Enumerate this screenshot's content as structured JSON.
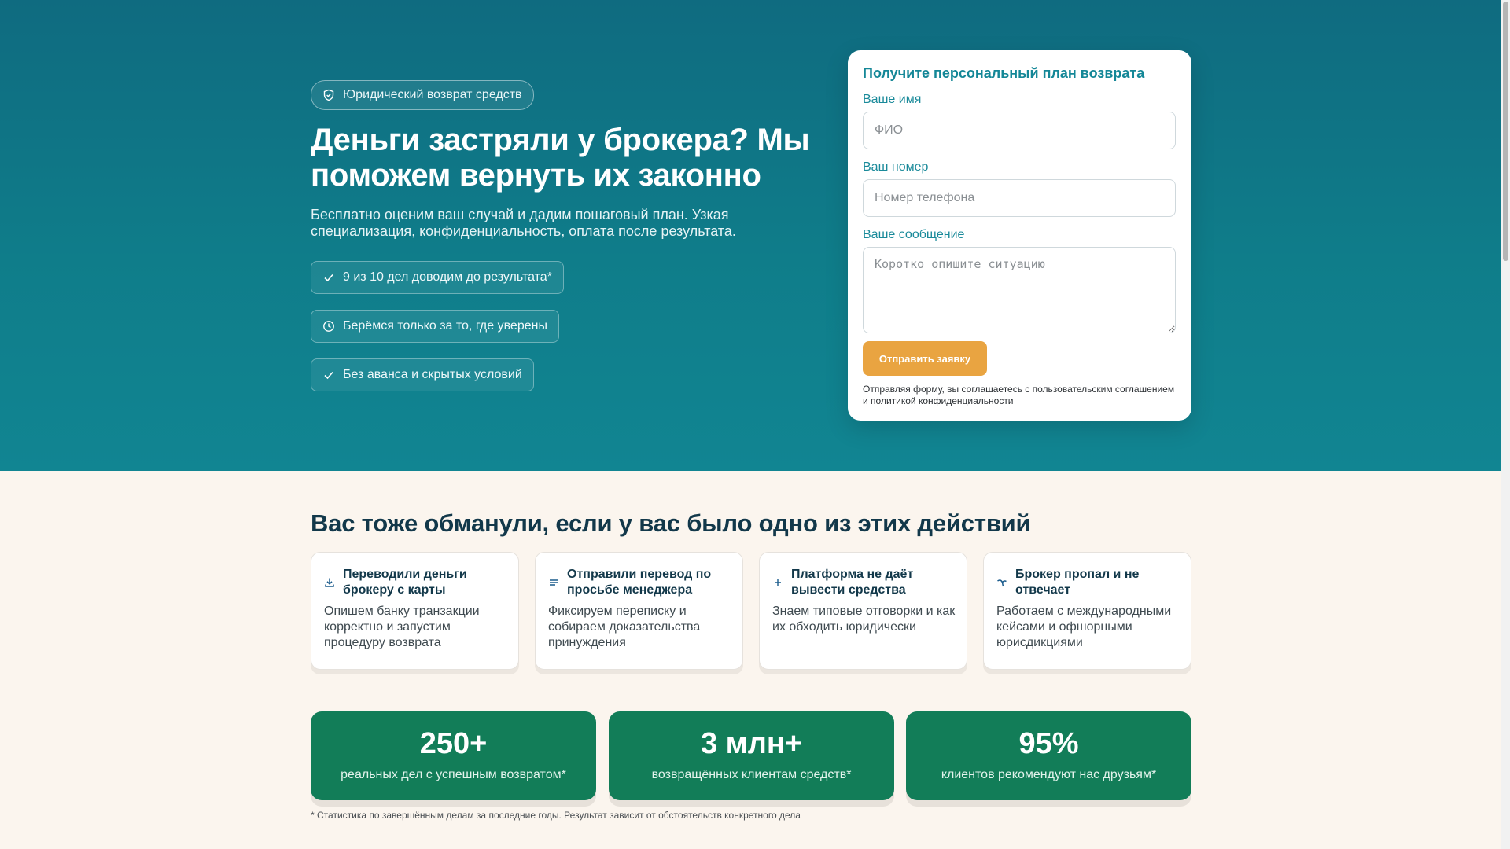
{
  "hero": {
    "badge": {
      "icon": "shield-icon",
      "label": "Юридический возврат средств"
    },
    "title": "Деньги застряли у брокера? Мы поможем вернуть их законно",
    "subtitle": "Бесплатно оценим ваш случай и дадим пошаговый план. Узкая специализация, конфиденциальность, оплата после результата.",
    "benefits": [
      {
        "icon": "check-icon",
        "label": "9 из 10 дел доводим до результата*"
      },
      {
        "icon": "clock-icon",
        "label": "Берёмся только за то, где уверены"
      },
      {
        "icon": "check-icon",
        "label": "Без аванса и скрытых условий"
      }
    ]
  },
  "form": {
    "title": "Получите персональный план возврата",
    "name_label": "Ваше имя",
    "name_placeholder": "ФИО",
    "phone_label": "Ваш номер",
    "phone_placeholder": "Номер телефона",
    "message_label": "Ваше сообщение",
    "message_placeholder": "Коротко опишите ситуацию",
    "submit_label": "Отправить заявку",
    "consent_note": "Отправляя форму, вы соглашаетесь с пользовательским соглашением и политикой конфиденциальности"
  },
  "section": {
    "title": "Вас тоже обманули, если у вас было одно из этих действий",
    "cards": [
      {
        "icon": "download-icon",
        "title": "Переводили деньги брокеру с карты",
        "text": "Опишем банку транзакции корректно и запустим процедуру возврата"
      },
      {
        "icon": "list-icon",
        "title": "Отправили перевод по просьбе менеджера",
        "text": "Фиксируем переписку и собираем доказательства принуждения"
      },
      {
        "icon": "plus-icon",
        "title": "Платформа не даёт вывести средства",
        "text": "Знаем типовые отговорки и как их обходить юридически"
      },
      {
        "icon": "trend-icon",
        "title": "Брокер пропал и не отвечает",
        "text": "Работаем с международными кейсами и офшорными юрисдикциями"
      }
    ]
  },
  "stats": [
    {
      "value": "250+",
      "label": "реальных дел с успешным возвратом*"
    },
    {
      "value": "3 млн+",
      "label": "возвращённых клиентам средств*"
    },
    {
      "value": "95%",
      "label": "клиентов рекомендуют нас друзьям*"
    }
  ],
  "footnote": "* Статистика по завершённым делам за последние годы. Результат зависит от обстоятельств конкретного дела",
  "colors": {
    "hero_top": "#0f6b80",
    "hero_bottom": "#118592",
    "accent_button": "#e9a441",
    "stat_green": "#127d58",
    "form_teal": "#148797",
    "page_bg": "#fbf5ee"
  }
}
